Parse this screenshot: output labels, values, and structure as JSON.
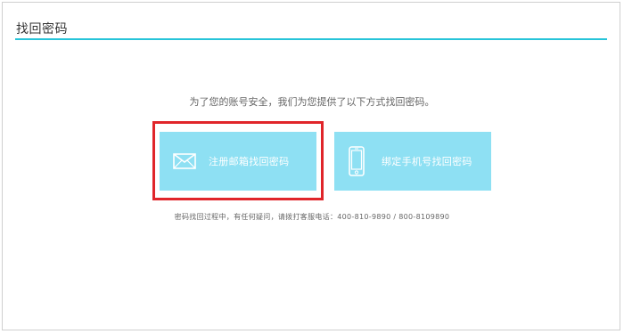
{
  "page": {
    "title": "找回密码"
  },
  "intro": {
    "text": "为了您的账号安全，我们为您提供了以下方式找回密码。"
  },
  "options": {
    "email": {
      "label": "注册邮箱找回密码",
      "icon": "envelope-icon"
    },
    "phone": {
      "label": "绑定手机号找回密码",
      "icon": "mobile-phone-icon"
    }
  },
  "hotline": {
    "text": "密码找回过程中，有任何疑问，请拨打客服电话：400-810-9890  /  800-8109890"
  },
  "colors": {
    "accent": "#27c4d9",
    "option_bg": "#8ee0f3",
    "highlight": "#e0252a"
  }
}
